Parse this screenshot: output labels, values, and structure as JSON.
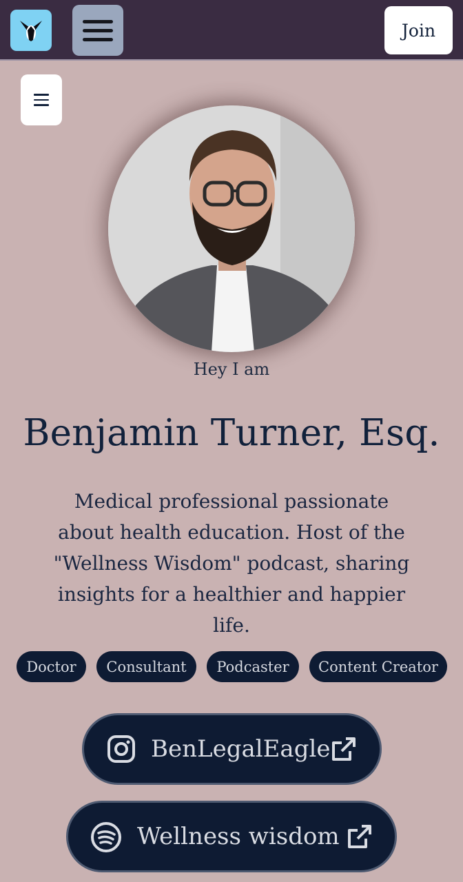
{
  "header": {
    "join_label": "Join"
  },
  "profile": {
    "greeting": "Hey I am",
    "name": "Benjamin Turner, Esq.",
    "bio": "Medical professional passionate about health education. Host of the \"Wellness Wisdom\" podcast, sharing insights for a healthier and happier life.",
    "tags": [
      "Doctor",
      "Consultant",
      "Podcaster",
      "Content Creator"
    ]
  },
  "links": [
    {
      "label": "BenLegalEagle",
      "icon": "instagram-icon",
      "action_icon": "external-link-icon"
    },
    {
      "label": "Wellness wisdom",
      "icon": "spotify-icon",
      "action_icon": "external-link-icon"
    }
  ],
  "colors": {
    "header_bg": "#3a2c42",
    "page_bg": "#c9b2b2",
    "pill_bg": "#0e1b33",
    "logo_bg": "#7fd2f3"
  }
}
